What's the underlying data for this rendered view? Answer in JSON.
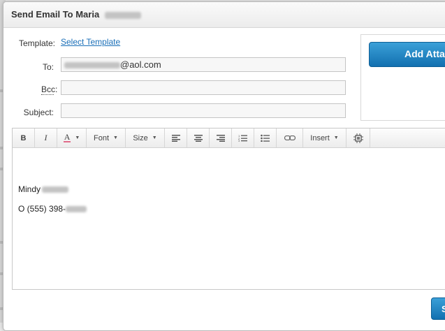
{
  "dialog": {
    "title": "Send Email To Maria"
  },
  "form": {
    "template_label": "Template:",
    "template_link": "Select Template",
    "to_label": "To:",
    "to_value_suffix": "@aol.com",
    "bcc_label": "Bcc:",
    "bcc_value": "",
    "subject_label": "Subject:",
    "subject_value": ""
  },
  "attachments": {
    "add_button": "Add Attac"
  },
  "toolbar": {
    "bold": "B",
    "italic": "I",
    "text_color": "A",
    "font": "Font",
    "size": "Size",
    "insert": "Insert",
    "icons": [
      "bold-icon",
      "italic-icon",
      "text-color-icon",
      "align-left-icon",
      "align-center-icon",
      "align-right-icon",
      "ordered-list-icon",
      "unordered-list-icon",
      "link-icon",
      "source-icon"
    ]
  },
  "message": {
    "signature_name": "Mindy",
    "signature_phone": "O (555) 398-"
  },
  "footer": {
    "send_button": "S"
  },
  "colors": {
    "primary_button": "#1a82c4",
    "link": "#1a6fb8",
    "text_color_underline": "#e06b8a"
  }
}
